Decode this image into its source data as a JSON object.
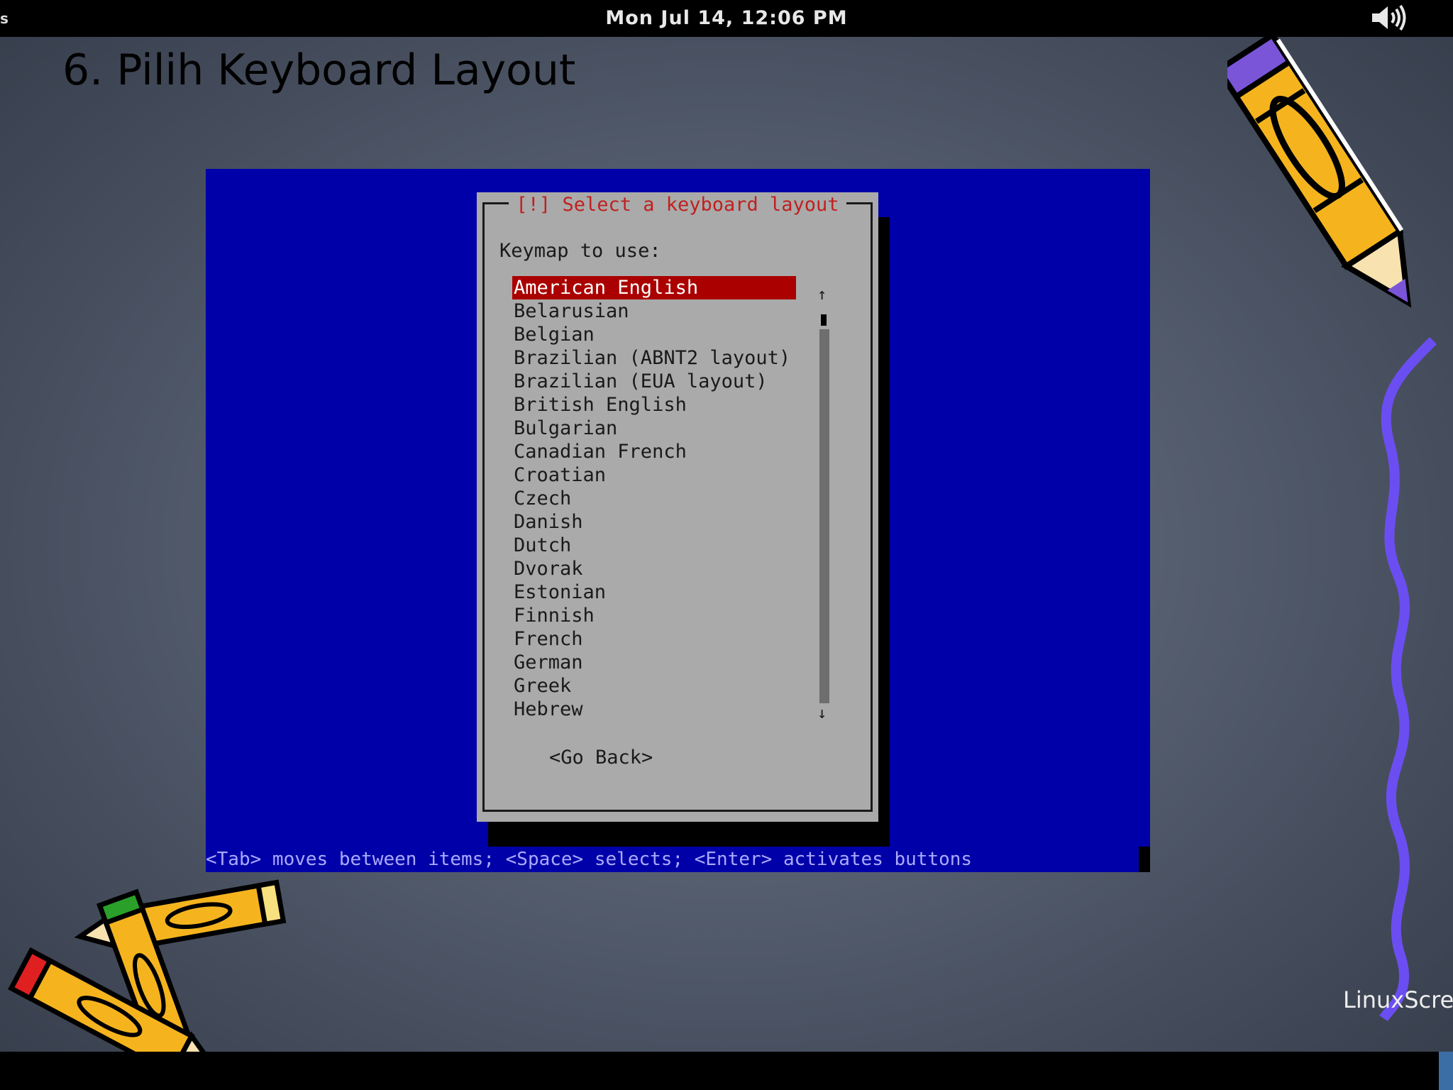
{
  "topbar": {
    "activities_fragment": "s",
    "clock": "Mon Jul 14, 12:06 PM",
    "volume_icon": "speaker-volume-icon"
  },
  "slide": {
    "title": "6. Pilih Keyboard Layout",
    "footer_label": "LinuxScre"
  },
  "installer": {
    "dialog_title": "[!] Select a keyboard layout",
    "prompt": "Keymap to use:",
    "options": [
      "American English",
      "Belarusian",
      "Belgian",
      "Brazilian (ABNT2 layout)",
      "Brazilian (EUA layout)",
      "British English",
      "Bulgarian",
      "Canadian French",
      "Croatian",
      "Czech",
      "Danish",
      "Dutch",
      "Dvorak",
      "Estonian",
      "Finnish",
      "French",
      "German",
      "Greek",
      "Hebrew"
    ],
    "selected_option": "American English",
    "scroll_up_glyph": "↑",
    "scroll_down_glyph": "↓",
    "go_back_button": "<Go Back>",
    "help_text": "<Tab> moves between items; <Space> selects; <Enter> activates buttons"
  },
  "colors": {
    "installer_background": "#0000a8",
    "dialog_background": "#aaaaaa",
    "dialog_title_text": "#c02020",
    "selection_background": "#aa0000",
    "help_text": "#aaaaff"
  },
  "decorations": [
    "pencil-clipart-icon",
    "crossed-pencils-clipart-icon",
    "purple-squiggle-line"
  ]
}
